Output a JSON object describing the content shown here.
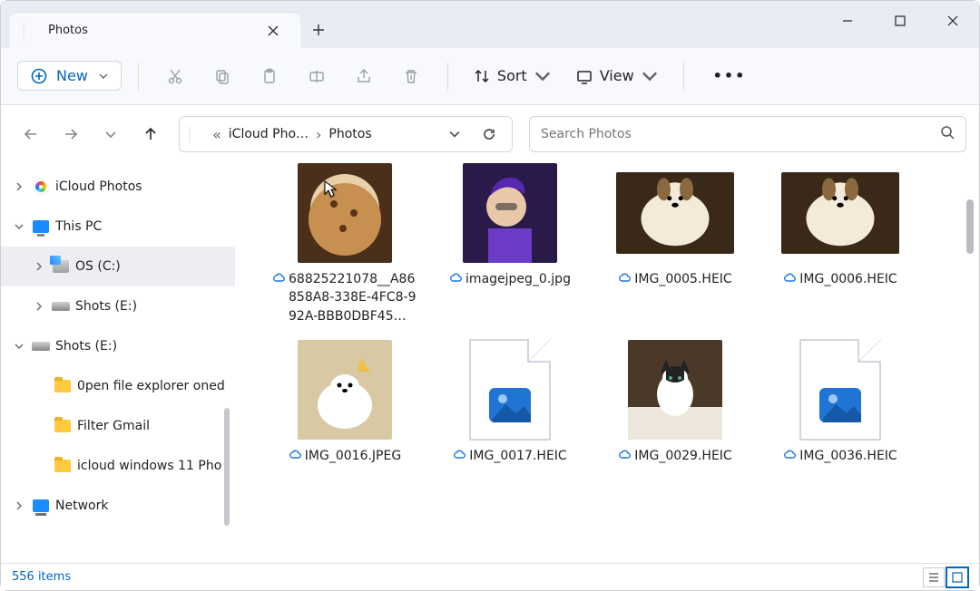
{
  "window": {
    "tab_title": "Photos"
  },
  "toolbar": {
    "new_label": "New",
    "sort_label": "Sort",
    "view_label": "View"
  },
  "breadcrumb": {
    "item1": "iCloud Pho…",
    "item2": "Photos"
  },
  "search": {
    "placeholder": "Search Photos"
  },
  "tree": {
    "icloud": "iCloud Photos",
    "thispc": "This PC",
    "osc": "OS (C:)",
    "shots1": "Shots (E:)",
    "shots2": "Shots (E:)",
    "f_open": "0pen file explorer oned",
    "f_filter": "Filter Gmail",
    "f_icloud": "icloud windows 11 Pho",
    "network": "Network"
  },
  "files": [
    {
      "name": "68825221078__A86858A8-338E-4FC8-992A-BBB0DBF45…",
      "kind": "cookies"
    },
    {
      "name": "imagejpeg_0.jpg",
      "kind": "selfie"
    },
    {
      "name": "IMG_0005.HEIC",
      "kind": "dog1"
    },
    {
      "name": "IMG_0006.HEIC",
      "kind": "dog1"
    },
    {
      "name": "IMG_0016.JPEG",
      "kind": "puppy"
    },
    {
      "name": "IMG_0017.HEIC",
      "kind": "doc"
    },
    {
      "name": "IMG_0029.HEIC",
      "kind": "cat"
    },
    {
      "name": "IMG_0036.HEIC",
      "kind": "doc"
    }
  ],
  "status": {
    "count": "556 items"
  }
}
